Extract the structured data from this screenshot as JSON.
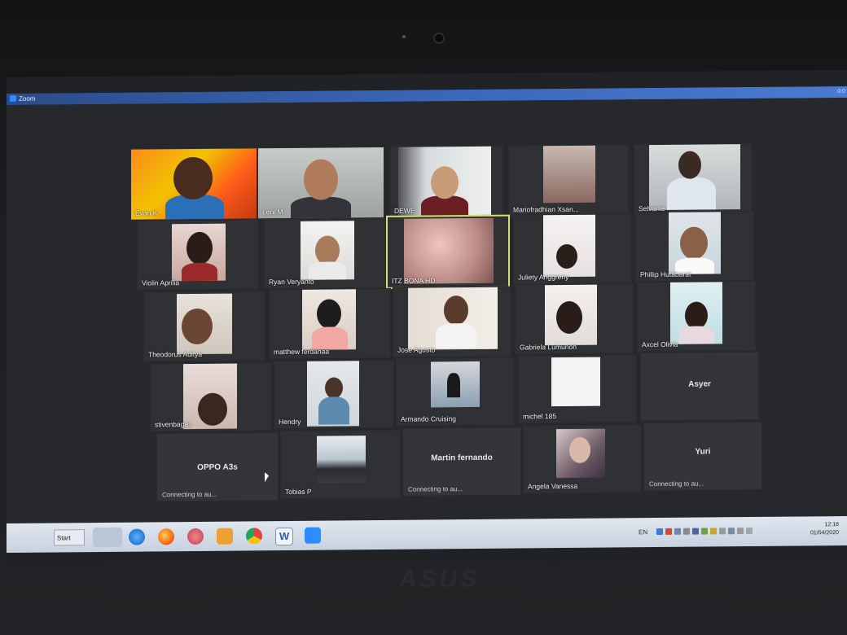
{
  "window": {
    "title": "Zoom",
    "right_text": "0:0"
  },
  "gallery": [
    {
      "name": "Evan K",
      "type": "video"
    },
    {
      "name": "Leni M",
      "type": "video"
    },
    {
      "name": "DEWE",
      "type": "video"
    },
    {
      "name": "Mariofradhian Xsan...",
      "type": "video"
    },
    {
      "name": "Selvanie",
      "type": "video"
    },
    {
      "name": "Violin Aprilia",
      "type": "video"
    },
    {
      "name": "Ryan Veryanto",
      "type": "video"
    },
    {
      "name": "ITZ BONA HD",
      "type": "video",
      "active": true
    },
    {
      "name": "Juliety Anggreny",
      "type": "video"
    },
    {
      "name": "Phillip Hutabarat",
      "type": "video"
    },
    {
      "name": "Theodorus Aditya",
      "type": "video"
    },
    {
      "name": "matthew ferdanaa",
      "type": "video"
    },
    {
      "name": "Jose Agusto",
      "type": "video"
    },
    {
      "name": "Gabriela Lumunon",
      "type": "video"
    },
    {
      "name": "Axcel Olivia",
      "type": "video"
    },
    {
      "name": "stivenbagas",
      "type": "video"
    },
    {
      "name": "Hendry",
      "type": "video"
    },
    {
      "name": "Armando Cruising",
      "type": "video"
    },
    {
      "name": "michel 185",
      "type": "video"
    },
    {
      "name": "Asyer",
      "type": "name-only"
    },
    {
      "name": "OPPO A3s",
      "type": "name-only",
      "status": "Connecting to au..."
    },
    {
      "name": "Tobias P",
      "type": "video"
    },
    {
      "name": "Martin fernando",
      "type": "name-only",
      "status": "Connecting to au..."
    },
    {
      "name": "Angela Vanessa",
      "type": "video"
    },
    {
      "name": "Yuri",
      "type": "name-only",
      "status": "Connecting to au..."
    }
  ],
  "taskbar": {
    "start_label": "Start",
    "apps": [
      "ie-icon",
      "firefox-icon",
      "chrome-alt-icon",
      "outlook-icon",
      "chrome-icon",
      "word-icon",
      "zoom-icon"
    ],
    "language": "EN",
    "time": "12:18",
    "date": "01/04/2020"
  },
  "brand": "ASUS"
}
